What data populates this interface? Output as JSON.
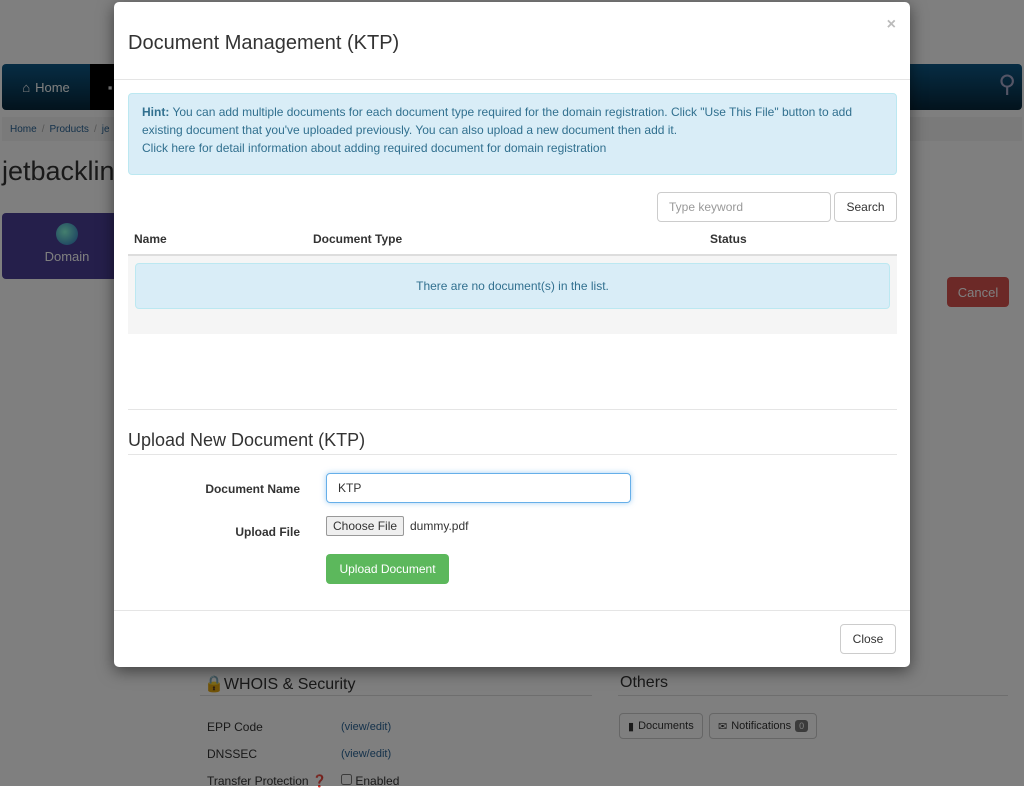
{
  "background": {
    "nav": {
      "home": "Home"
    },
    "breadcrumb": [
      "Home",
      "Products",
      "je"
    ],
    "page_title": "jetbacklink",
    "domain_tile": "Domain",
    "cancel": "Cancel",
    "whois": {
      "title": "WHOIS & Security",
      "epp": "EPP Code",
      "dnssec": "DNSSEC",
      "transfer": "Transfer Protection",
      "view_edit": "(view/edit)",
      "enabled": "Enabled"
    },
    "others": {
      "title": "Others",
      "documents": "Documents",
      "notifications": "Notifications",
      "notif_count": "0"
    }
  },
  "modal": {
    "title": "Document Management (KTP)",
    "close_x": "×",
    "hint": {
      "label": "Hint:",
      "text": " You can add multiple documents for each document type required for the domain registration. Click \"Use This File\" button to add existing document that you've uploaded previously. You can also upload a new document then add it.",
      "link": "Click here",
      "link_rest": " for detail information about adding required document for domain registration"
    },
    "search": {
      "placeholder": "Type keyword",
      "button": "Search"
    },
    "table": {
      "headers": [
        "Name",
        "Document Type",
        "Status"
      ],
      "empty": "There are no document(s) in the list."
    },
    "upload": {
      "title": "Upload New Document (KTP)",
      "name_label": "Document Name",
      "name_value": "KTP",
      "file_label": "Upload File",
      "choose": "Choose File",
      "file_name": "dummy.pdf",
      "button": "Upload Document"
    },
    "close": "Close"
  }
}
